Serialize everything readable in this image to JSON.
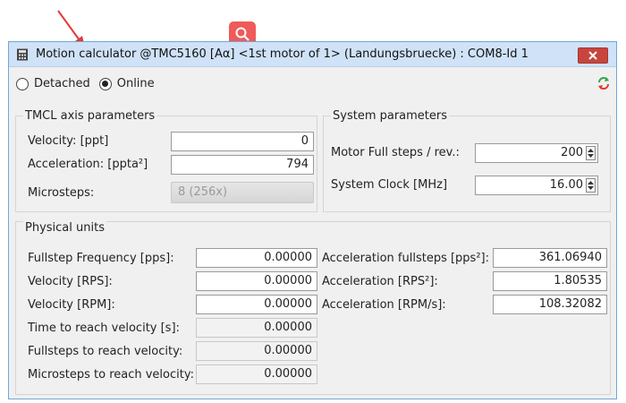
{
  "window": {
    "title": "Motion calculator @TMC5160 [Aα] <1st motor of 1> (Landungsbruecke) : COM8-Id 1"
  },
  "mode": {
    "detached_label": "Detached",
    "online_label": "Online",
    "selected": "Online"
  },
  "tmcl": {
    "title": "TMCL axis parameters",
    "velocity_label": "Velocity: [ppt]",
    "velocity_value": "0",
    "acceleration_label": "Acceleration: [ppta²]",
    "acceleration_value": "794",
    "microsteps_label": "Microsteps:",
    "microsteps_value": "8 (256x)"
  },
  "system": {
    "title": "System parameters",
    "fullsteps_label": "Motor Full steps / rev.:",
    "fullsteps_value": "200",
    "clock_label": "System Clock [MHz]",
    "clock_value": "16.00"
  },
  "physical": {
    "title": "Physical units",
    "left": [
      {
        "label": "Fullstep Frequency [pps]:",
        "value": "0.00000",
        "readonly": false
      },
      {
        "label": "Velocity [RPS]:",
        "value": "0.00000",
        "readonly": false
      },
      {
        "label": "Velocity [RPM]:",
        "value": "0.00000",
        "readonly": false
      },
      {
        "label": "Time to reach velocity [s]:",
        "value": "0.00000",
        "readonly": true
      },
      {
        "label": "Fullsteps to reach velocity:",
        "value": "0.00000",
        "readonly": true
      },
      {
        "label": "Microsteps to reach velocity:",
        "value": "0.00000",
        "readonly": true
      }
    ],
    "right": [
      {
        "label": "Acceleration fullsteps [pps²]:",
        "value": "361.06940"
      },
      {
        "label": "Acceleration [RPS²]:",
        "value": "1.80535"
      },
      {
        "label": "Acceleration [RPM/s]:",
        "value": "108.32082"
      }
    ]
  },
  "icons": {
    "window_icon": "calculator-icon",
    "close": "close-icon",
    "refresh": "refresh-icon",
    "overlay": "search-icon",
    "annotation": "red-arrow"
  },
  "colors": {
    "titlebar": "#cfe2f7",
    "close_button": "#c7453d",
    "overlay": "#ef5a5a",
    "annotation_arrow": "#e53935"
  }
}
